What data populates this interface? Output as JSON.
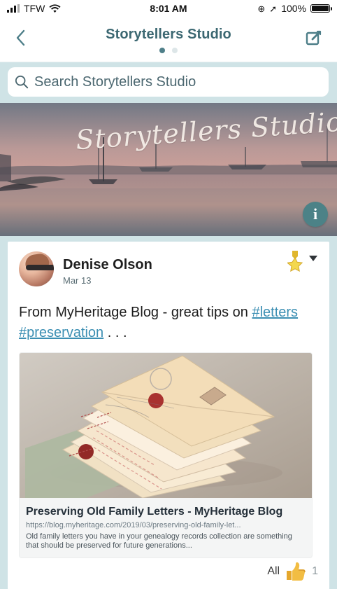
{
  "status_bar": {
    "carrier": "TFW",
    "time": "8:01 AM",
    "battery": "100%",
    "battery_level": 1.0
  },
  "nav": {
    "title": "Storytellers Studio",
    "active_page": 1,
    "page_count": 2
  },
  "search": {
    "placeholder": "Search Storytellers Studio"
  },
  "banner": {
    "title": "Storytellers Studio"
  },
  "post": {
    "author": "Denise Olson",
    "date": "Mar 13",
    "text_prefix": "From MyHeritage Blog - great tips on ",
    "tag_1": "#letters",
    "tag_2": "#preservation",
    "text_suffix": " . . .",
    "preview": {
      "title": "Preserving Old Family Letters - MyHeritage Blog",
      "url": "https://blog.myheritage.com/2019/03/preserving-old-family-let...",
      "description": "Old family letters you have in your genealogy records collection are something that should be preserved for future generations..."
    },
    "reactions": {
      "filter_label": "All",
      "count": "1"
    }
  },
  "colors": {
    "brand_teal": "#4d7e88",
    "page_background": "#cfe3e6",
    "link_blue": "#3c8fb3"
  },
  "icons": {
    "back": "chevron-left-icon",
    "compose": "compose-icon",
    "search": "search-icon",
    "info": "info-icon",
    "feature": "star-icon",
    "menu": "chevron-down-icon",
    "reaction": "thumbs-up-icon"
  }
}
